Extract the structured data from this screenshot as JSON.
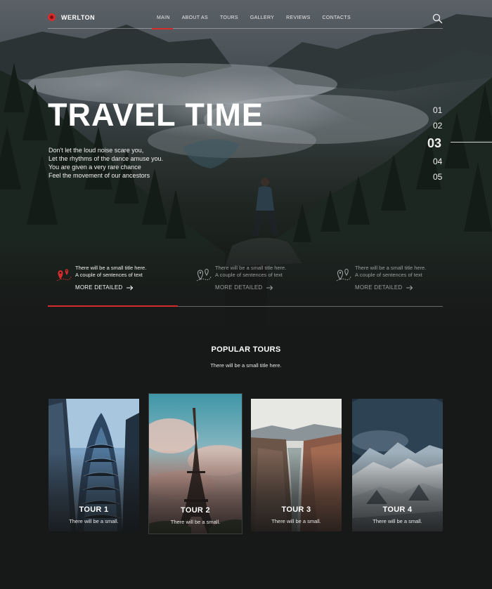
{
  "brand": {
    "name": "WERLTON",
    "accent": "#d62b2b"
  },
  "nav": {
    "items": [
      {
        "label": "MAIN",
        "active": true
      },
      {
        "label": "ABOUT AS",
        "active": false
      },
      {
        "label": "TOURS",
        "active": false
      },
      {
        "label": "GALLERY",
        "active": false
      },
      {
        "label": "REVIEWS",
        "active": false
      },
      {
        "label": "CONTACTS",
        "active": false
      }
    ],
    "search_icon": "search-icon"
  },
  "hero": {
    "title": "TRAVEL TIME",
    "lines": [
      "Don't let the loud noise scare you,",
      "Let the rhythms of the dance amuse you.",
      "You are given a very rare chance",
      "Feel the movement of our ancestors"
    ],
    "pager": {
      "pages": [
        "01",
        "02",
        "03",
        "04",
        "05"
      ],
      "active": "03"
    }
  },
  "features": [
    {
      "text1": "There will be a small title here.",
      "text2": "A couple of sentences of text",
      "more": "MORE DETAILED",
      "icon": "map-pins-icon",
      "active": true
    },
    {
      "text1": "There will be a small title here.",
      "text2": "A couple of sentences of text",
      "more": "MORE DETAILED",
      "icon": "map-pins-icon",
      "active": false
    },
    {
      "text1": "There will be a small title here.",
      "text2": "A couple of sentences of text",
      "more": "MORE DETAILED",
      "icon": "map-pins-icon",
      "active": false
    }
  ],
  "slider_progress": 0.33,
  "popular": {
    "title": "POPULAR TOURS",
    "subtitle": "There will be a small title here.",
    "tours": [
      {
        "name": "TOUR 1",
        "desc": "There will be a small."
      },
      {
        "name": "TOUR 2",
        "desc": "There will be a small."
      },
      {
        "name": "TOUR 3",
        "desc": "There will be a small."
      },
      {
        "name": "TOUR 4",
        "desc": "There will be a small."
      }
    ]
  }
}
